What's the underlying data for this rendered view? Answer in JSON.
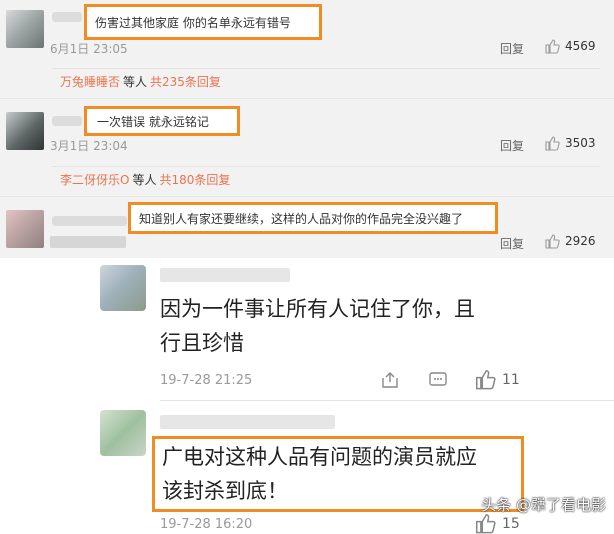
{
  "top_comments": [
    {
      "text": "伤害过其他家庭  你的名单永远有错号",
      "time": "6月1日 23:05",
      "reply": "回复",
      "likes": "4569",
      "sub_name": "万兔睡睡否",
      "sub_mid": "等人",
      "sub_count": "共235条回复"
    },
    {
      "text": "一次错误  就永远铭记",
      "time": "3月1日 23:04",
      "reply": "回复",
      "likes": "3503",
      "sub_name": "李二伢伢乐O",
      "sub_mid": "等人",
      "sub_count": "共180条回复"
    },
    {
      "text": "知道别人有家还要继续，这样的人品对你的作品完全没兴趣了",
      "time": "",
      "reply": "回复",
      "likes": "2926"
    }
  ],
  "bottom_comments": [
    {
      "text_line1": "因为一件事让所有人记住了你，且",
      "text_line2": "行且珍惜",
      "time": "19-7-28 21:25",
      "likes": "11"
    },
    {
      "text_line1": "广电对这种人品有问题的演员就应",
      "text_line2": "该封杀到底！",
      "time": "19-7-28 16:20",
      "likes": "15"
    }
  ],
  "watermark": "头条 @犟了看电影",
  "colors": {
    "highlight": "#f08c22",
    "reply_name": "#eb7350"
  },
  "icons": [
    "thumb-up-icon",
    "share-icon",
    "comment-icon"
  ]
}
